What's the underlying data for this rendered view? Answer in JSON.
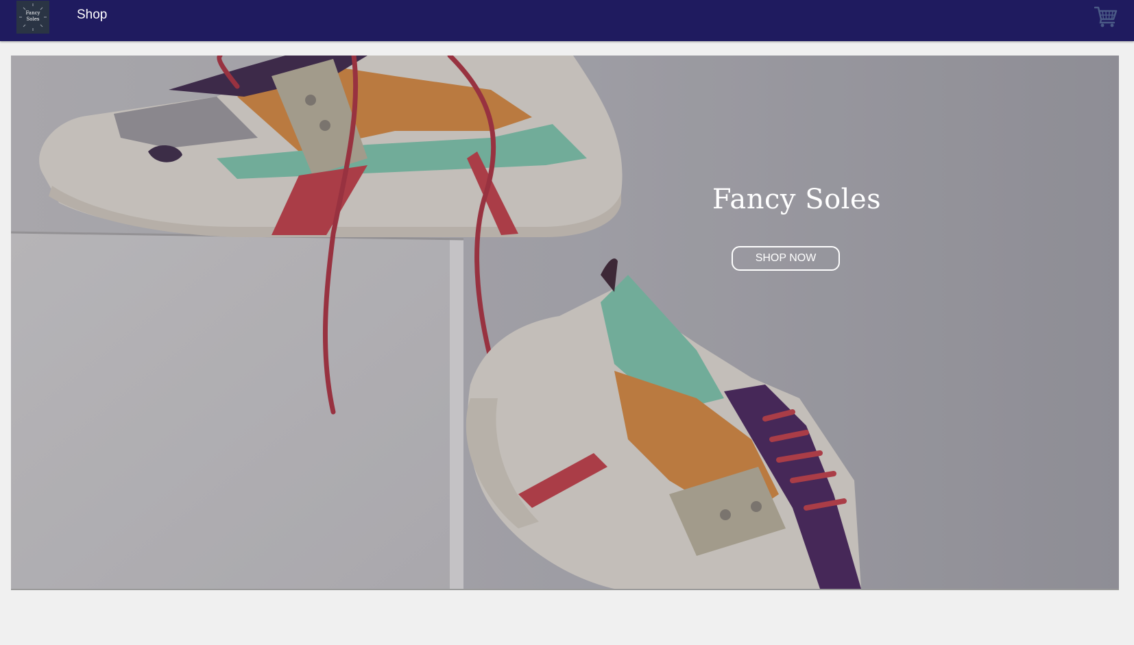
{
  "navbar": {
    "logo_line1": "Fancy",
    "logo_line2": "Soles",
    "shop_link": "Shop",
    "cart_icon": "shopping-cart-icon"
  },
  "hero": {
    "title": "Fancy Soles",
    "cta_label": "SHOP NOW",
    "image": "sneakers-on-white-block"
  },
  "colors": {
    "navbar_bg": "#1f1b5f",
    "page_bg": "#f0f0f0",
    "cart_icon": "#4a5a86",
    "text": "#ffffff"
  }
}
